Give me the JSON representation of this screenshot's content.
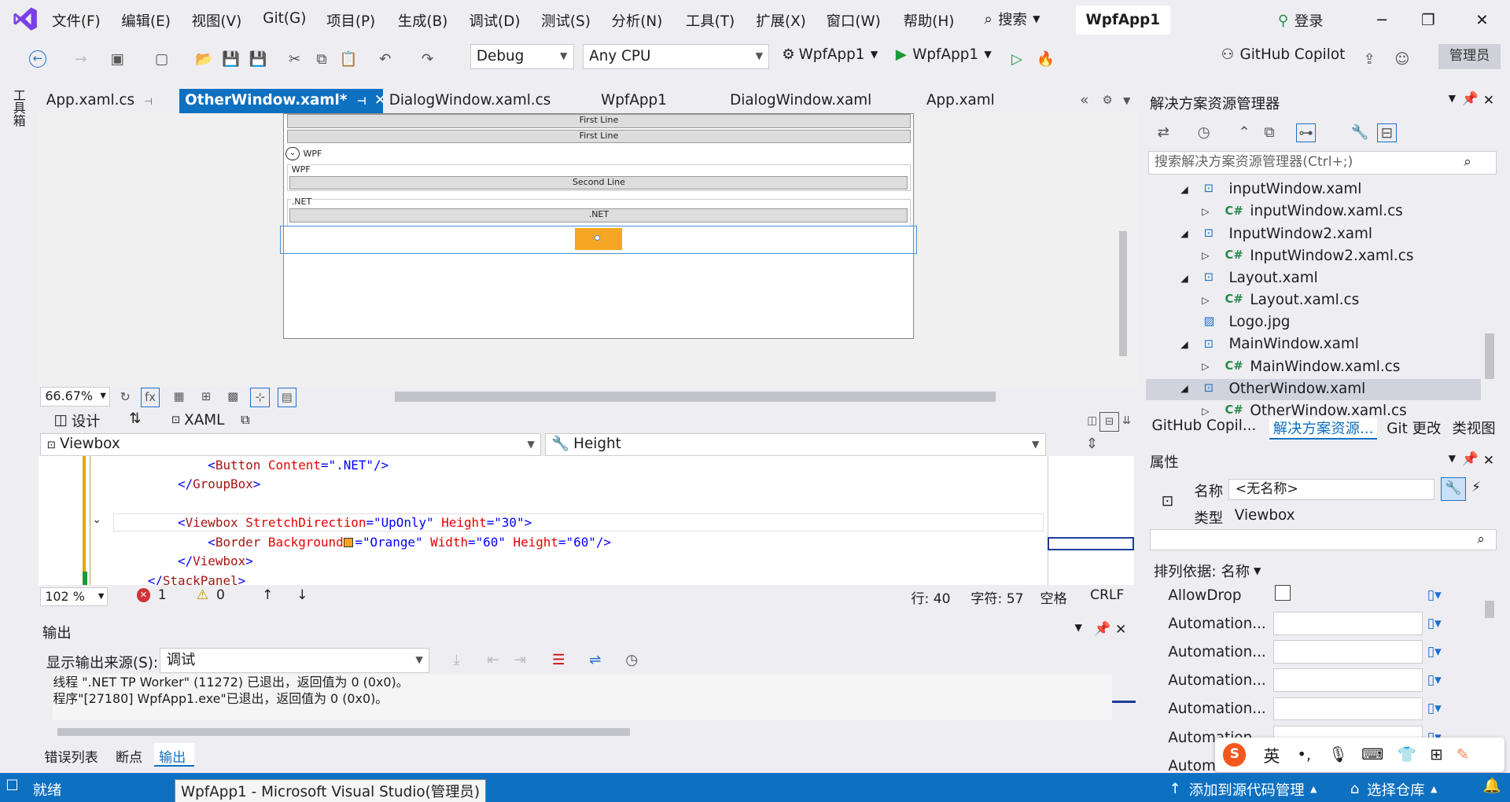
{
  "menu": [
    "文件(F)",
    "编辑(E)",
    "视图(V)",
    "Git(G)",
    "项目(P)",
    "生成(B)",
    "调试(D)",
    "测试(S)",
    "分析(N)",
    "工具(T)",
    "扩展(X)",
    "窗口(W)",
    "帮助(H)"
  ],
  "search_label": "搜索",
  "app_title": "WpfApp1",
  "login_label": "登录",
  "toolbar": {
    "config": "Debug",
    "platform": "Any CPU",
    "startup_project": "WpfApp1",
    "run_label": "WpfApp1",
    "copilot": "GitHub Copilot",
    "admin": "管理员"
  },
  "left_toolbox": "工具箱",
  "doc_tabs": [
    "App.xaml.cs",
    "OtherWindow.xaml*",
    "DialogWindow.xaml.cs",
    "WpfApp1",
    "DialogWindow.xaml",
    "App.xaml"
  ],
  "preview": {
    "btn1": "First Line",
    "btn2": "First Line",
    "group1_header": "WPF",
    "group1_label": "WPF",
    "btn3": "Second Line",
    "group2_label": ".NET",
    "btn4": ".NET"
  },
  "zoom_designer": "66.67%",
  "design_tab": "设计",
  "xaml_tab": "XAML",
  "nav_left": "Viewbox",
  "nav_right": "Height",
  "code_lines": [
    {
      "indent": "            ",
      "parts": [
        [
          "br",
          "<"
        ],
        [
          "tag",
          "Button"
        ],
        [
          "attr",
          " Content"
        ],
        [
          "br",
          "="
        ],
        [
          "val",
          "\".NET\""
        ],
        [
          "br",
          "/>"
        ]
      ]
    },
    {
      "indent": "        ",
      "parts": [
        [
          "br",
          "</"
        ],
        [
          "tag",
          "GroupBox"
        ],
        [
          "br",
          ">"
        ]
      ]
    },
    {
      "indent": "",
      "parts": []
    },
    {
      "indent": "        ",
      "parts": [
        [
          "br",
          "<"
        ],
        [
          "tag",
          "Viewbox"
        ],
        [
          "attr",
          " StretchDirection"
        ],
        [
          "br",
          "="
        ],
        [
          "val",
          "\"UpOnly\""
        ],
        [
          "attr",
          " Height"
        ],
        [
          "br",
          "="
        ],
        [
          "val",
          "\"30\""
        ],
        [
          "br",
          ">"
        ]
      ]
    },
    {
      "indent": "            ",
      "parts": [
        [
          "br",
          "<"
        ],
        [
          "tag",
          "Border"
        ],
        [
          "attr",
          " Background"
        ],
        [
          "br",
          "="
        ],
        [
          "val",
          "\"Orange\""
        ],
        [
          "attr",
          " Width"
        ],
        [
          "br",
          "="
        ],
        [
          "val",
          "\"60\""
        ],
        [
          "attr",
          " Height"
        ],
        [
          "br",
          "="
        ],
        [
          "val",
          "\"60\""
        ],
        [
          "br",
          "/>"
        ]
      ]
    },
    {
      "indent": "        ",
      "parts": [
        [
          "br",
          "</"
        ],
        [
          "tag",
          "Viewbox"
        ],
        [
          "br",
          ">"
        ]
      ]
    },
    {
      "indent": "    ",
      "parts": [
        [
          "br",
          "</"
        ],
        [
          "tag",
          "StackPanel"
        ],
        [
          "br",
          ">"
        ]
      ]
    }
  ],
  "editor_status": {
    "zoom": "102 %",
    "errors": "1",
    "warnings": "0",
    "line": "行: 40",
    "char": "字符: 57",
    "ws": "空格",
    "eol": "CRLF"
  },
  "output": {
    "title": "输出",
    "source_label": "显示输出来源(S):",
    "source": "调试",
    "lines": [
      "线程 \".NET TP Worker\" (11272) 已退出，返回值为 0 (0x0)。",
      "程序\"[27180] WpfApp1.exe\"已退出，返回值为 0 (0x0)。"
    ]
  },
  "bottom_tabs": [
    "错误列表",
    "断点",
    "输出"
  ],
  "status": {
    "ready": "就绪",
    "tooltip": "WpfApp1 - Microsoft Visual Studio(管理员)",
    "add_source": "添加到源代码管理",
    "select_repo": "选择仓库"
  },
  "solution": {
    "title": "解决方案资源管理器",
    "search_placeholder": "搜索解决方案资源管理器(Ctrl+;)",
    "items": [
      {
        "label": "inputWindow.xaml",
        "type": "xaml",
        "level": 0,
        "expanded": true
      },
      {
        "label": "inputWindow.xaml.cs",
        "type": "cs",
        "level": 1
      },
      {
        "label": "InputWindow2.xaml",
        "type": "xaml",
        "level": 0,
        "expanded": true
      },
      {
        "label": "InputWindow2.xaml.cs",
        "type": "cs",
        "level": 1
      },
      {
        "label": "Layout.xaml",
        "type": "xaml",
        "level": 0,
        "expanded": true
      },
      {
        "label": "Layout.xaml.cs",
        "type": "cs",
        "level": 1
      },
      {
        "label": "Logo.jpg",
        "type": "img",
        "level": 0
      },
      {
        "label": "MainWindow.xaml",
        "type": "xaml",
        "level": 0,
        "expanded": true
      },
      {
        "label": "MainWindow.xaml.cs",
        "type": "cs",
        "level": 1
      },
      {
        "label": "OtherWindow.xaml",
        "type": "xaml",
        "level": 0,
        "expanded": true,
        "selected": true
      },
      {
        "label": "OtherWindow.xaml.cs",
        "type": "cs",
        "level": 1
      }
    ],
    "tabs": [
      "GitHub Copil...",
      "解决方案资源...",
      "Git 更改",
      "类视图"
    ]
  },
  "properties": {
    "title": "属性",
    "name_label": "名称",
    "name_value": "<无名称>",
    "type_label": "类型",
    "type_value": "Viewbox",
    "sort_label": "排列依据: 名称",
    "rows": [
      "AllowDrop",
      "Automation...",
      "Automation...",
      "Automation...",
      "Automation...",
      "Automation...",
      "Automation..."
    ]
  },
  "ime": {
    "lang": "英"
  }
}
